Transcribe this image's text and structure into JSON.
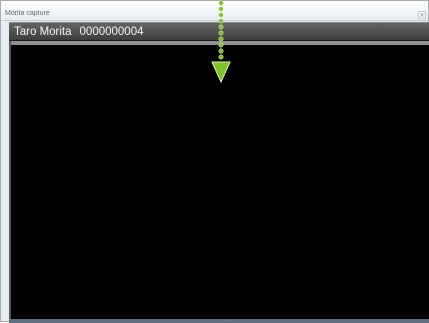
{
  "window": {
    "title": "Morita capture",
    "close_glyph": "×"
  },
  "infobar": {
    "patient_name": "Taro Morita",
    "patient_id": "0000000004"
  },
  "viewport": {
    "background": "#000000"
  },
  "pointer": {
    "icon": "dotted-arrow-down-icon",
    "color": "#7fbf2a"
  }
}
